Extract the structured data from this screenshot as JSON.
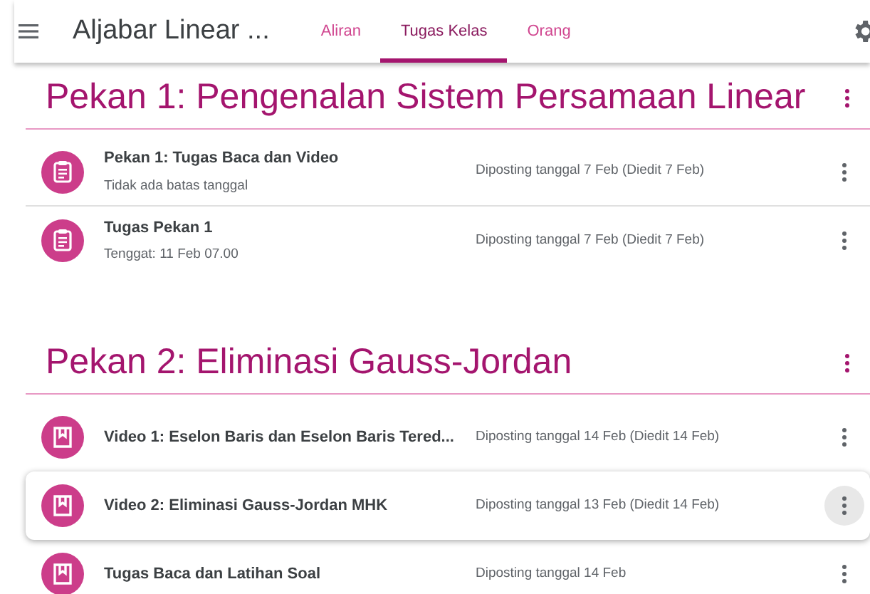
{
  "header": {
    "title": "Aljabar Linear ...",
    "tabs": [
      {
        "label": "Aliran",
        "selected": false
      },
      {
        "label": "Tugas Kelas",
        "selected": true
      },
      {
        "label": "Orang",
        "selected": false
      }
    ]
  },
  "topics": [
    {
      "title": "Pekan 1: Pengenalan Sistem Persamaan Linear",
      "items": [
        {
          "kind": "assignment",
          "title": "Pekan 1: Tugas Baca dan Video",
          "subtitle": "Tidak ada batas tanggal",
          "posted": "Diposting tanggal 7 Feb (Diedit 7 Feb)",
          "highlighted": false
        },
        {
          "kind": "assignment",
          "title": "Tugas Pekan 1",
          "subtitle": "Tenggat: 11 Feb 07.00",
          "posted": "Diposting tanggal 7 Feb (Diedit 7 Feb)",
          "highlighted": false
        }
      ]
    },
    {
      "title": "Pekan 2: Eliminasi Gauss-Jordan",
      "items": [
        {
          "kind": "material",
          "title": "Video 1: Eselon Baris dan Eselon Baris Tered...",
          "posted": "Diposting tanggal 14 Feb (Diedit 14 Feb)",
          "highlighted": false
        },
        {
          "kind": "material",
          "title": "Video 2: Eliminasi Gauss-Jordan MHK",
          "posted": "Diposting tanggal 13 Feb (Diedit 14 Feb)",
          "highlighted": true
        },
        {
          "kind": "material",
          "title": "Tugas Baca dan Latihan Soal",
          "posted": "Diposting tanggal 14 Feb",
          "highlighted": false
        }
      ]
    }
  ]
}
